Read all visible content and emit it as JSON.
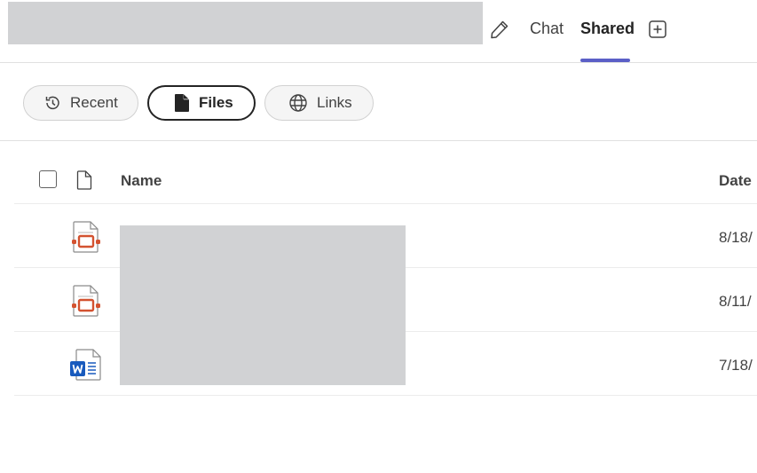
{
  "header": {
    "tabs": [
      {
        "label": "Chat",
        "active": false
      },
      {
        "label": "Shared",
        "active": true
      }
    ],
    "accent_color": "#5b5fc7"
  },
  "filters": [
    {
      "label": "Recent",
      "icon": "history-icon",
      "selected": false
    },
    {
      "label": "Files",
      "icon": "file-icon",
      "selected": true
    },
    {
      "label": "Links",
      "icon": "globe-icon",
      "selected": false
    }
  ],
  "table": {
    "columns": {
      "name": "Name",
      "date": "Date"
    },
    "rows": [
      {
        "type": "powerpoint",
        "icon": "powerpoint-file-icon",
        "name": "",
        "date": "8/18/"
      },
      {
        "type": "powerpoint",
        "icon": "powerpoint-file-icon",
        "name": "",
        "date": "8/11/"
      },
      {
        "type": "word",
        "icon": "word-file-icon",
        "name": "",
        "date": "7/18/"
      }
    ]
  }
}
